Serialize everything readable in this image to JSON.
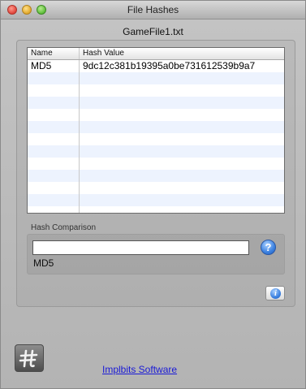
{
  "window": {
    "title": "File Hashes"
  },
  "file": {
    "name": "GameFile1.txt"
  },
  "table": {
    "headers": {
      "name": "Name",
      "hash": "Hash Value"
    },
    "rows": [
      {
        "name": "MD5",
        "hash": "9dc12c381b19395a0be731612539b9a7"
      },
      {
        "name": "",
        "hash": ""
      },
      {
        "name": "",
        "hash": ""
      },
      {
        "name": "",
        "hash": ""
      },
      {
        "name": "",
        "hash": ""
      },
      {
        "name": "",
        "hash": ""
      },
      {
        "name": "",
        "hash": ""
      },
      {
        "name": "",
        "hash": ""
      },
      {
        "name": "",
        "hash": ""
      },
      {
        "name": "",
        "hash": ""
      },
      {
        "name": "",
        "hash": ""
      },
      {
        "name": "",
        "hash": ""
      },
      {
        "name": "",
        "hash": ""
      }
    ]
  },
  "comparison": {
    "label": "Hash Comparison",
    "input_value": "",
    "algorithm": "MD5",
    "help_symbol": "?"
  },
  "footer": {
    "info_symbol": "i",
    "app_icon_glyph": "#",
    "company": "Implbits Software"
  },
  "colors": {
    "row_stripe": "#edf3fe",
    "link": "#1a1ad6",
    "help_blue": "#3d82e0"
  }
}
